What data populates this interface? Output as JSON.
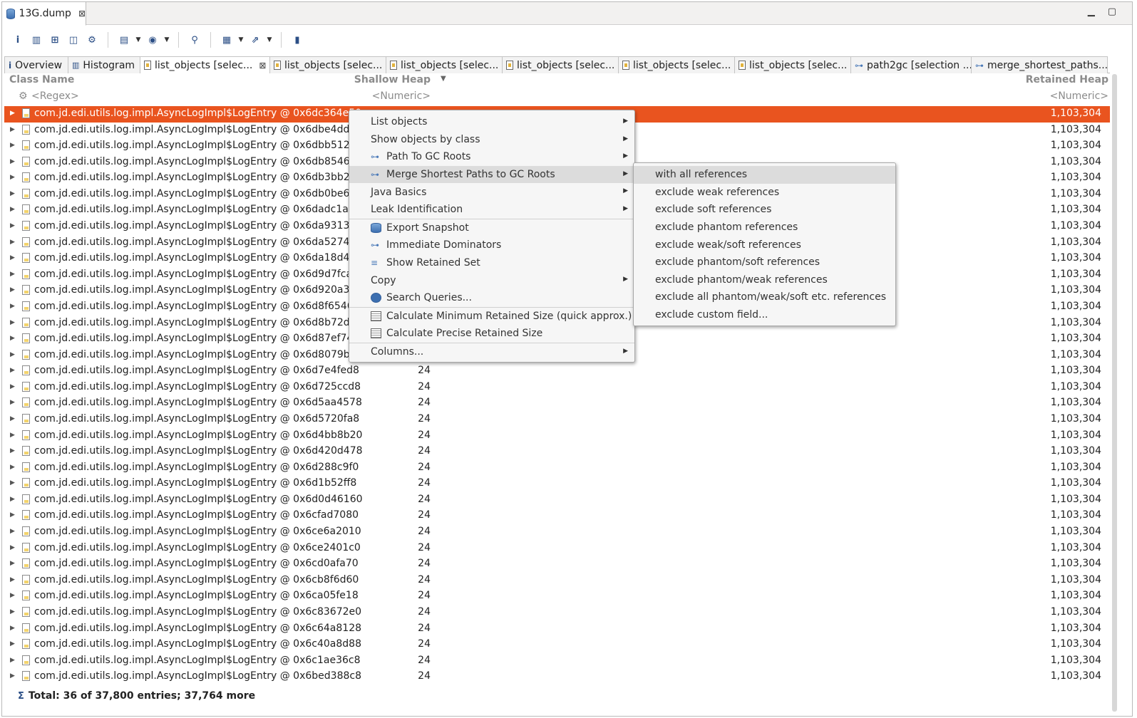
{
  "editor_tab": {
    "title": "13G.dump",
    "close": "⊠"
  },
  "window_controls": {
    "minimize": "▁",
    "maximize": "▢"
  },
  "toolbar": {
    "items": [
      "info-icon",
      "histogram-icon",
      "dominator-tree-icon",
      "oql-icon",
      "heap-dump-overview-icon",
      "run-report-icon",
      "query-browser-icon",
      "find-object-icon",
      "group-by-icon",
      "export-icon",
      "calculate-retained-icon"
    ]
  },
  "tabs": [
    {
      "label": "Overview",
      "icon": "info-icon"
    },
    {
      "label": "Histogram",
      "icon": "histogram-icon"
    },
    {
      "label": "list_objects  [selec...",
      "icon": "doc-icon",
      "active": true,
      "close": "⊠"
    },
    {
      "label": "list_objects  [selec...",
      "icon": "doc-icon"
    },
    {
      "label": "list_objects  [selec...",
      "icon": "doc-icon"
    },
    {
      "label": "list_objects  [selec...",
      "icon": "doc-icon"
    },
    {
      "label": "list_objects  [selec...",
      "icon": "doc-icon"
    },
    {
      "label": "list_objects  [selec...",
      "icon": "doc-icon"
    },
    {
      "label": "path2gc  [selection ...",
      "icon": "tree-icon"
    },
    {
      "label": "merge_shortest_paths...",
      "icon": "tree-icon"
    }
  ],
  "table": {
    "headers": {
      "class_name": "Class Name",
      "shallow_heap": "Shallow Heap",
      "retained_heap": "Retained Heap"
    },
    "filters": {
      "class_name": "<Regex>",
      "shallow_heap": "<Numeric>",
      "retained_heap": "<Numeric>"
    },
    "rows": [
      {
        "label": "com.jd.edi.utils.log.impl.AsyncLogImpl$LogEntry @ 0x6dc364e50",
        "shallow": "",
        "retained": "1,103,304",
        "selected": true
      },
      {
        "label": "com.jd.edi.utils.log.impl.AsyncLogImpl$LogEntry @ 0x6dbe4dda8",
        "shallow": "",
        "retained": "1,103,304"
      },
      {
        "label": "com.jd.edi.utils.log.impl.AsyncLogImpl$LogEntry @ 0x6dbb51228",
        "shallow": "",
        "retained": "1,103,304"
      },
      {
        "label": "com.jd.edi.utils.log.impl.AsyncLogImpl$LogEntry @ 0x6db854690",
        "shallow": "",
        "retained": "1,103,304"
      },
      {
        "label": "com.jd.edi.utils.log.impl.AsyncLogImpl$LogEntry @ 0x6db3bb230",
        "shallow": "",
        "retained": "1,103,304"
      },
      {
        "label": "com.jd.edi.utils.log.impl.AsyncLogImpl$LogEntry @ 0x6db0be630",
        "shallow": "",
        "retained": "1,103,304"
      },
      {
        "label": "com.jd.edi.utils.log.impl.AsyncLogImpl$LogEntry @ 0x6dadc1a98",
        "shallow": "",
        "retained": "1,103,304"
      },
      {
        "label": "com.jd.edi.utils.log.impl.AsyncLogImpl$LogEntry @ 0x6da931330",
        "shallow": "",
        "retained": "1,103,304"
      },
      {
        "label": "com.jd.edi.utils.log.impl.AsyncLogImpl$LogEntry @ 0x6da5274f0",
        "shallow": "",
        "retained": "1,103,304"
      },
      {
        "label": "com.jd.edi.utils.log.impl.AsyncLogImpl$LogEntry @ 0x6da18d408",
        "shallow": "",
        "retained": "1,103,304"
      },
      {
        "label": "com.jd.edi.utils.log.impl.AsyncLogImpl$LogEntry @ 0x6d9d7fca8",
        "shallow": "",
        "retained": "1,103,304"
      },
      {
        "label": "com.jd.edi.utils.log.impl.AsyncLogImpl$LogEntry @ 0x6d920a328",
        "shallow": "",
        "retained": "1,103,304"
      },
      {
        "label": "com.jd.edi.utils.log.impl.AsyncLogImpl$LogEntry @ 0x6d8f65460",
        "shallow": "",
        "retained": "1,103,304"
      },
      {
        "label": "com.jd.edi.utils.log.impl.AsyncLogImpl$LogEntry @ 0x6d8b72d10",
        "shallow": "",
        "retained": "1,103,304"
      },
      {
        "label": "com.jd.edi.utils.log.impl.AsyncLogImpl$LogEntry @ 0x6d87ef740",
        "shallow": "",
        "retained": "1,103,304"
      },
      {
        "label": "com.jd.edi.utils.log.impl.AsyncLogImpl$LogEntry @ 0x6d8079b08",
        "shallow": "",
        "retained": "1,103,304"
      },
      {
        "label": "com.jd.edi.utils.log.impl.AsyncLogImpl$LogEntry @ 0x6d7e4fed8",
        "shallow": "24",
        "retained": "1,103,304"
      },
      {
        "label": "com.jd.edi.utils.log.impl.AsyncLogImpl$LogEntry @ 0x6d725ccd8",
        "shallow": "24",
        "retained": "1,103,304"
      },
      {
        "label": "com.jd.edi.utils.log.impl.AsyncLogImpl$LogEntry @ 0x6d5aa4578",
        "shallow": "24",
        "retained": "1,103,304"
      },
      {
        "label": "com.jd.edi.utils.log.impl.AsyncLogImpl$LogEntry @ 0x6d5720fa8",
        "shallow": "24",
        "retained": "1,103,304"
      },
      {
        "label": "com.jd.edi.utils.log.impl.AsyncLogImpl$LogEntry @ 0x6d4bb8b20",
        "shallow": "24",
        "retained": "1,103,304"
      },
      {
        "label": "com.jd.edi.utils.log.impl.AsyncLogImpl$LogEntry @ 0x6d420d478",
        "shallow": "24",
        "retained": "1,103,304"
      },
      {
        "label": "com.jd.edi.utils.log.impl.AsyncLogImpl$LogEntry @ 0x6d288c9f0",
        "shallow": "24",
        "retained": "1,103,304"
      },
      {
        "label": "com.jd.edi.utils.log.impl.AsyncLogImpl$LogEntry @ 0x6d1b52ff8",
        "shallow": "24",
        "retained": "1,103,304"
      },
      {
        "label": "com.jd.edi.utils.log.impl.AsyncLogImpl$LogEntry @ 0x6d0d46160",
        "shallow": "24",
        "retained": "1,103,304"
      },
      {
        "label": "com.jd.edi.utils.log.impl.AsyncLogImpl$LogEntry @ 0x6cfad7080",
        "shallow": "24",
        "retained": "1,103,304"
      },
      {
        "label": "com.jd.edi.utils.log.impl.AsyncLogImpl$LogEntry @ 0x6ce6a2010",
        "shallow": "24",
        "retained": "1,103,304"
      },
      {
        "label": "com.jd.edi.utils.log.impl.AsyncLogImpl$LogEntry @ 0x6ce2401c0",
        "shallow": "24",
        "retained": "1,103,304"
      },
      {
        "label": "com.jd.edi.utils.log.impl.AsyncLogImpl$LogEntry @ 0x6cd0afa70",
        "shallow": "24",
        "retained": "1,103,304"
      },
      {
        "label": "com.jd.edi.utils.log.impl.AsyncLogImpl$LogEntry @ 0x6cb8f6d60",
        "shallow": "24",
        "retained": "1,103,304"
      },
      {
        "label": "com.jd.edi.utils.log.impl.AsyncLogImpl$LogEntry @ 0x6ca05fe18",
        "shallow": "24",
        "retained": "1,103,304"
      },
      {
        "label": "com.jd.edi.utils.log.impl.AsyncLogImpl$LogEntry @ 0x6c83672e0",
        "shallow": "24",
        "retained": "1,103,304"
      },
      {
        "label": "com.jd.edi.utils.log.impl.AsyncLogImpl$LogEntry @ 0x6c64a8128",
        "shallow": "24",
        "retained": "1,103,304"
      },
      {
        "label": "com.jd.edi.utils.log.impl.AsyncLogImpl$LogEntry @ 0x6c40a8d88",
        "shallow": "24",
        "retained": "1,103,304"
      },
      {
        "label": "com.jd.edi.utils.log.impl.AsyncLogImpl$LogEntry @ 0x6c1ae36c8",
        "shallow": "24",
        "retained": "1,103,304"
      },
      {
        "label": "com.jd.edi.utils.log.impl.AsyncLogImpl$LogEntry @ 0x6bed388c8",
        "shallow": "24",
        "retained": "1,103,304"
      }
    ],
    "total": "Total: 36 of 37,800 entries; 37,764 more"
  },
  "context_menu": {
    "items": [
      {
        "label": "List objects",
        "submenu": true
      },
      {
        "label": "Show objects by class",
        "submenu": true
      },
      {
        "label": "Path To GC Roots",
        "submenu": true,
        "icon": "path-to-gc-icon"
      },
      {
        "label": "Merge Shortest Paths to GC Roots",
        "submenu": true,
        "icon": "merge-paths-icon",
        "highlighted": true
      },
      {
        "label": "Java Basics",
        "submenu": true
      },
      {
        "label": "Leak Identification",
        "submenu": true
      },
      {
        "label": "Export Snapshot",
        "icon": "export-snapshot-icon"
      },
      {
        "label": "Immediate Dominators",
        "icon": "dominators-icon"
      },
      {
        "label": "Show Retained Set",
        "icon": "retained-set-icon"
      },
      {
        "label": "Copy",
        "submenu": true
      },
      {
        "label": "Search Queries...",
        "icon": "search-queries-icon"
      },
      {
        "label": "Calculate Minimum Retained Size (quick approx.)",
        "icon": "calculator-icon"
      },
      {
        "label": "Calculate Precise Retained Size",
        "icon": "calculator-icon"
      },
      {
        "label": "Columns...",
        "submenu": true
      }
    ]
  },
  "submenu": {
    "items": [
      "with all references",
      "exclude weak references",
      "exclude soft references",
      "exclude phantom references",
      "exclude weak/soft references",
      "exclude phantom/soft references",
      "exclude phantom/weak references",
      "exclude all phantom/weak/soft etc. references",
      "exclude custom field..."
    ]
  },
  "colors": {
    "selection": "#e9541f",
    "menu_bg": "#f6f6f6",
    "menu_highlight": "#dcdcdc"
  }
}
